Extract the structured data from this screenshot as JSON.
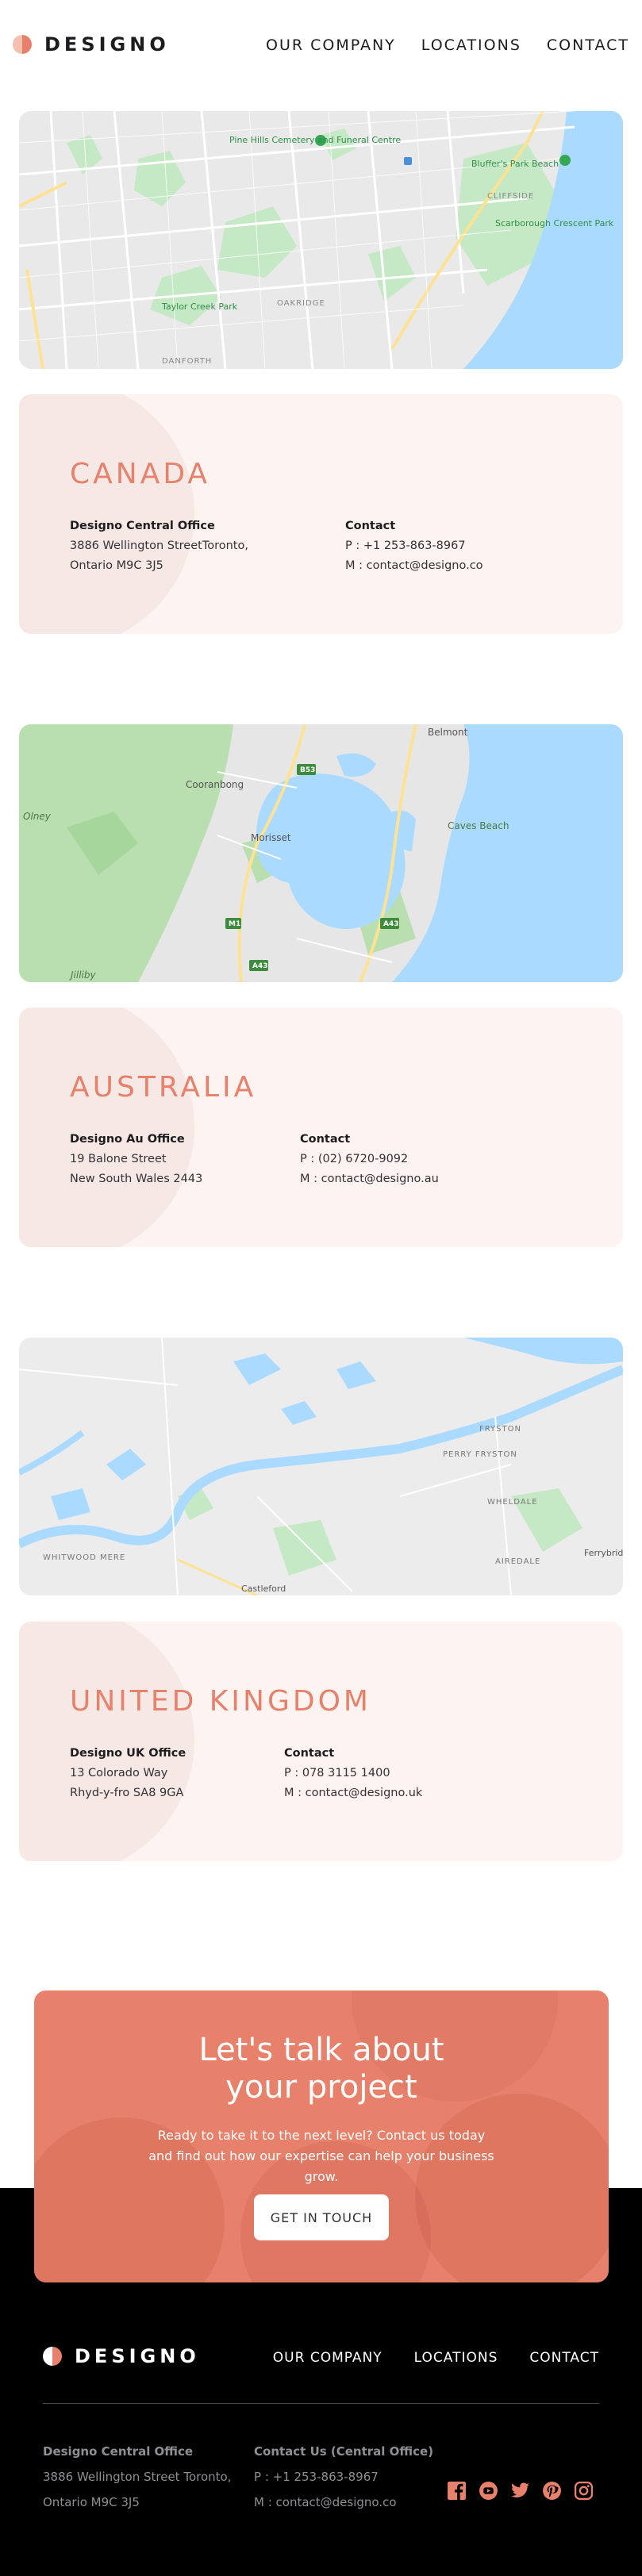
{
  "brand": {
    "name": "DESIGNO"
  },
  "nav": {
    "items": [
      "OUR COMPANY",
      "LOCATIONS",
      "CONTACT"
    ]
  },
  "maps": [
    {
      "labels": [
        "Pine Hills Cemetery and Funeral Centre",
        "Bluffer's Park Beach",
        "CLIFFSIDE",
        "Scarborough Crescent Park",
        "Taylor Creek Park",
        "OAKRIDGE",
        "DANFORTH"
      ]
    },
    {
      "labels": [
        "Belmont",
        "Cooranbong",
        "Morisset",
        "Olney",
        "Caves Beach",
        "Jilliby",
        "B53",
        "M1",
        "A43",
        "A43"
      ]
    },
    {
      "labels": [
        "FRYSTON",
        "PERRY FRYSTON",
        "WHELDALE",
        "AIREDALE",
        "WHITWOOD MERE",
        "Castleford",
        "Ferrybridge"
      ]
    }
  ],
  "locations": [
    {
      "country": "CANADA",
      "office_title": "Designo Central Office",
      "address1": "3886 Wellington StreetToronto,",
      "address2": "Ontario M9C 3J5",
      "contact_title": "Contact",
      "phone": "P : +1 253-863-8967",
      "email": "M : contact@designo.co"
    },
    {
      "country": "AUSTRALIA",
      "office_title": "Designo Au Office",
      "address1": "19 Balone Street",
      "address2": "New South Wales 2443",
      "contact_title": "Contact",
      "phone": "P : (02) 6720-9092",
      "email": "M : contact@designo.au"
    },
    {
      "country": "UNITED KINGDOM",
      "office_title": "Designo UK Office",
      "address1": "13 Colorado Way",
      "address2": "Rhyd-y-fro SA8 9GA",
      "contact_title": "Contact",
      "phone": "P : 078 3115 1400",
      "email": "M : contact@designo.uk"
    }
  ],
  "cta": {
    "title_line1": "Let's talk about",
    "title_line2": "your project",
    "body": "Ready to take it to the next level? Contact us today and find out how our expertise can help your business grow.",
    "button": "GET IN TOUCH"
  },
  "footer": {
    "nav": [
      "OUR COMPANY",
      "LOCATIONS",
      "CONTACT"
    ],
    "office_title": "Designo Central Office",
    "office_line1": "3886 Wellington Street Toronto,",
    "office_line2": "Ontario M9C 3J5",
    "contact_title": "Contact Us (Central Office)",
    "phone": "P : +1 253-863-8967",
    "email": "M : contact@designo.co",
    "socials": [
      "facebook-icon",
      "youtube-icon",
      "twitter-icon",
      "pinterest-icon",
      "instagram-icon"
    ]
  },
  "colors": {
    "accent": "#E7816B",
    "peach_light": "#FDF3F0",
    "dark": "#1D1C1E"
  }
}
